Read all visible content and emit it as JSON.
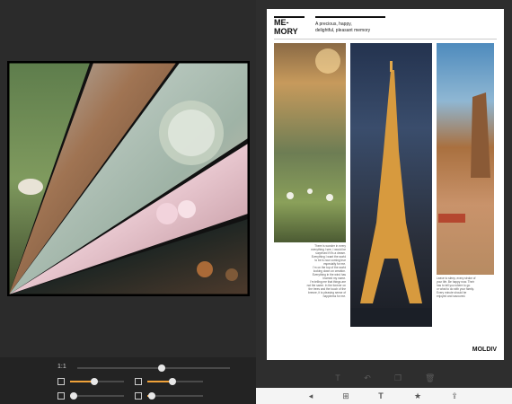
{
  "collage": {
    "slices": [
      "sheep-photo",
      "logs-photo",
      "cactus-photo",
      "blossom-photo",
      "lights-photo"
    ]
  },
  "controls": {
    "ratio_label": "1:1",
    "ratio_value": 0.55,
    "border_left_value": 0.45,
    "border_right_value": 0.45,
    "shadow_value": 0.25,
    "roundness_value": 0.25
  },
  "page": {
    "title": "ME-\nMORY",
    "subtitle": "A precious, happy,\ndelightful, pleasant memory",
    "caption_left": "There is wonder in every\neverything I see, I would be\nsurprised if it's a dream.\nEverything I want the world\nto be is now coming true\nespecially for me.\nI'm on the top of the world\nlooking down on creation.\nEverything in the wind has\nlearned my name.\nI'm telling me that things are\nnot the same. In the forever on\nthe trees and the touch of the\nbreeze, it is pleasing sense of\nhappiness for me.",
    "caption_right": "Leave to sleep, every stroke of\nyour life. Be happy now. Their\nhas to tell you where to go\nor what to do with your family.\nEvery minute should be\nenjoyed and savoured.",
    "brand": "MOLDIV"
  },
  "toolbar_top": {
    "icons": [
      "text-icon",
      "undo-icon",
      "copy-icon",
      "delete-icon"
    ]
  },
  "toolbar_bottom": {
    "icons": [
      "back-icon",
      "layout-icon",
      "text-icon",
      "star-icon",
      "share-icon"
    ]
  },
  "colors": {
    "accent": "#f0a23a"
  }
}
